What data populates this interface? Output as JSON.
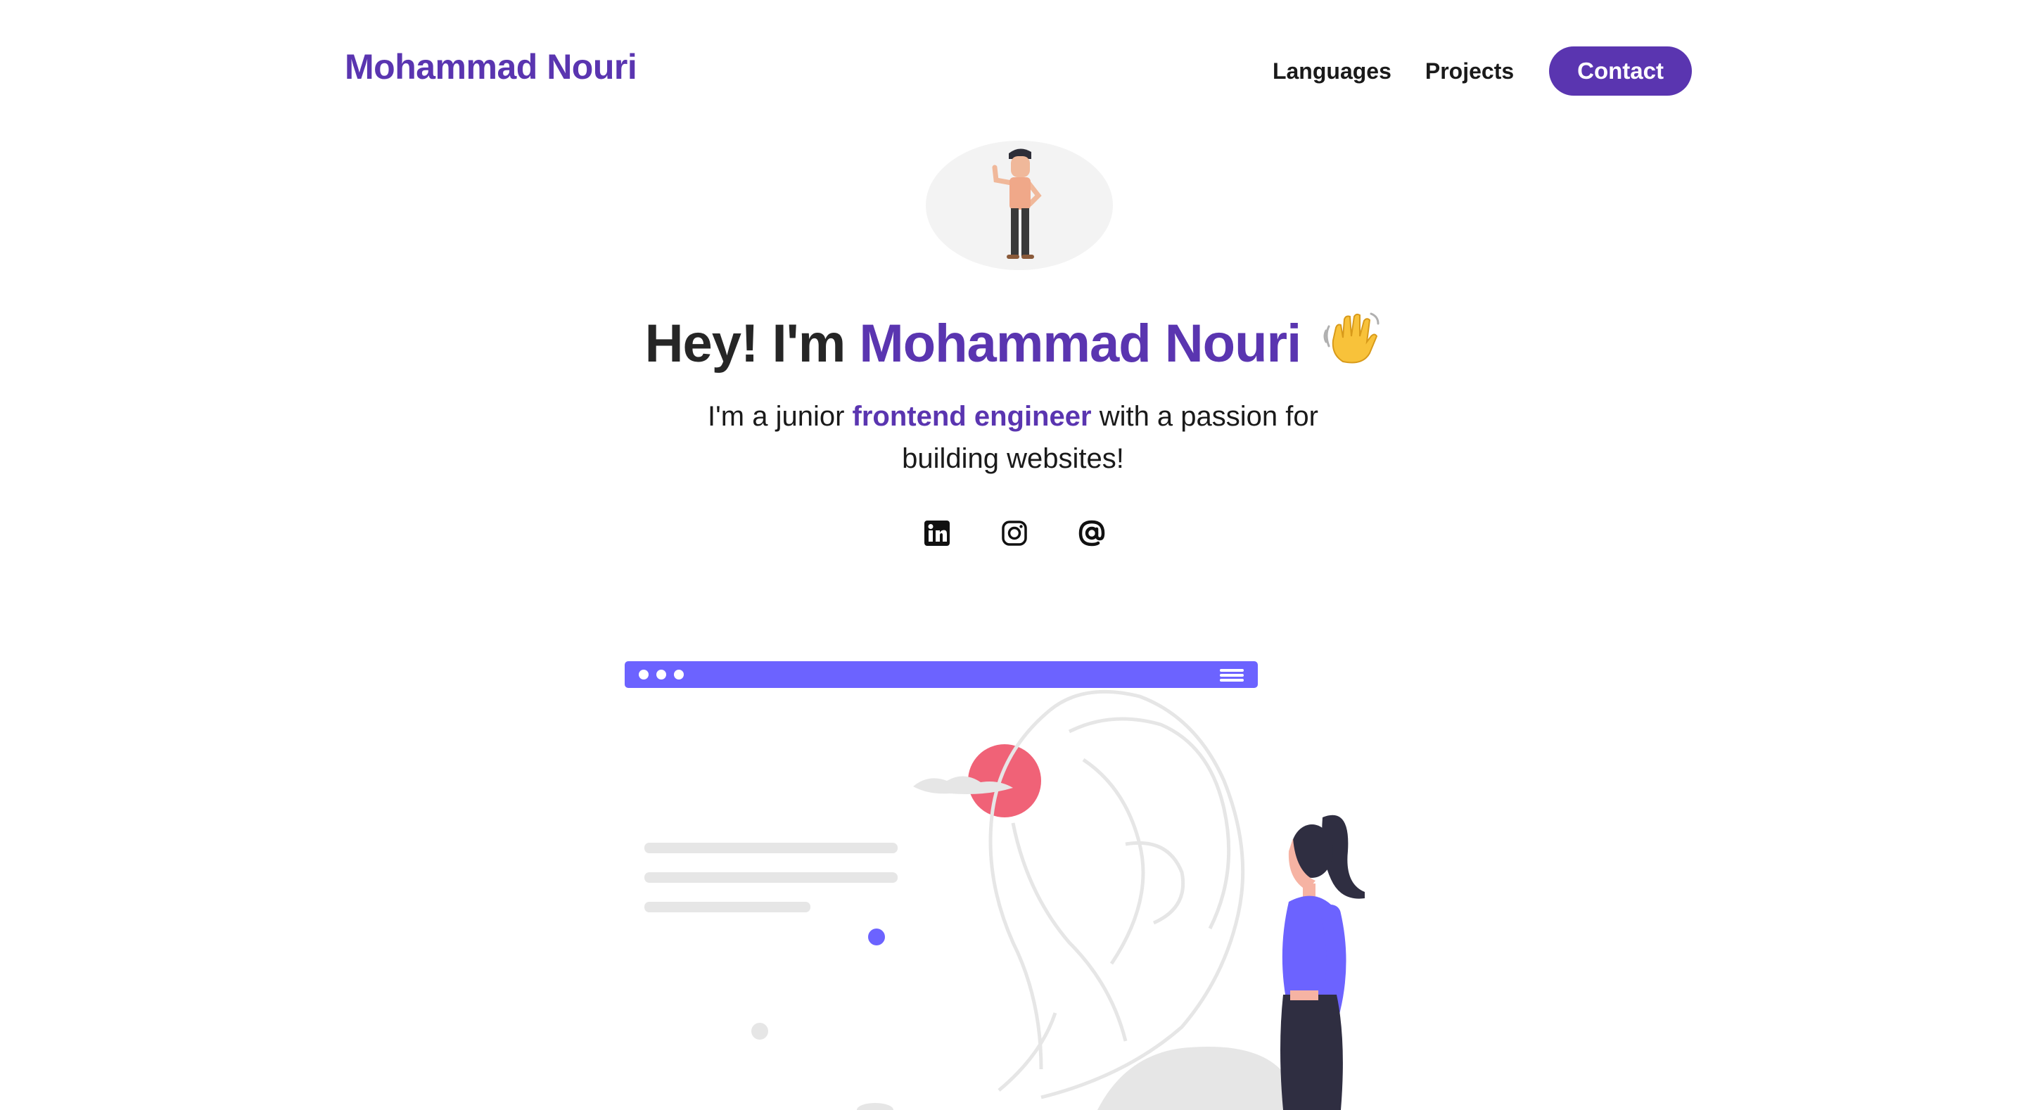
{
  "header": {
    "brand": "Mohammad Nouri",
    "nav": {
      "languages": "Languages",
      "projects": "Projects",
      "contact": "Contact"
    }
  },
  "hero": {
    "greeting": "Hey! I'm",
    "name": "Mohammad Nouri",
    "subtitle_pre": "I'm a junior",
    "subtitle_accent": "frontend engineer",
    "subtitle_post": "with a passion for building websites!"
  },
  "socials": [
    {
      "icon": "linkedin-icon"
    },
    {
      "icon": "instagram-icon"
    },
    {
      "icon": "email-at-icon"
    }
  ],
  "colors": {
    "brand": "#5a35b0",
    "illustration_accent": "#6c63ff",
    "illustration_pink": "#f06277",
    "text": "#1a1a1a"
  }
}
